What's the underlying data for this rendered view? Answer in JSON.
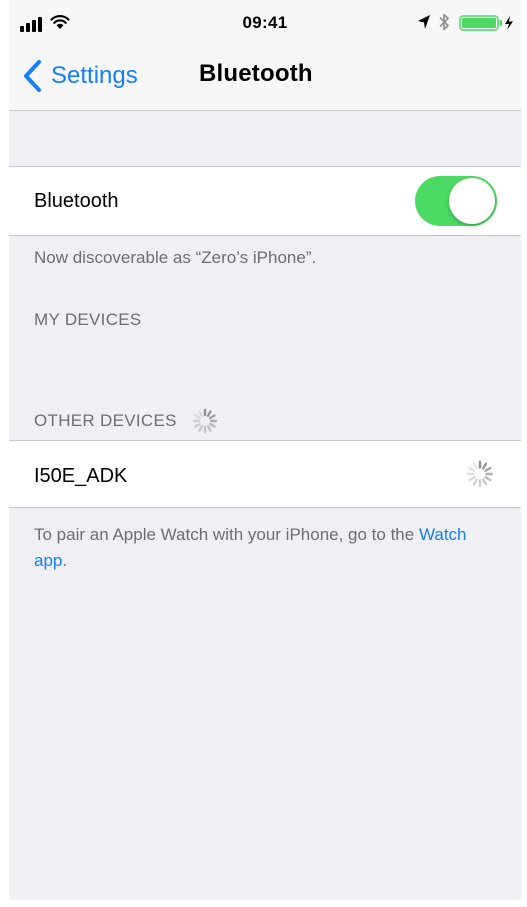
{
  "status_bar": {
    "time": "09:41",
    "icons": [
      "signal-bars-icon",
      "wifi-icon",
      "location-arrow-icon",
      "bluetooth-icon",
      "battery-charging-icon"
    ]
  },
  "nav": {
    "back_label": "Settings",
    "title": "Bluetooth"
  },
  "bluetooth_toggle": {
    "label": "Bluetooth",
    "state": "on"
  },
  "discoverable_text": "Now discoverable as “Zero’s iPhone”.",
  "my_devices": {
    "header": "MY DEVICES",
    "items": []
  },
  "other_devices": {
    "header": "OTHER DEVICES",
    "items": [
      {
        "name": "I50E_ADK",
        "status": "connecting"
      }
    ]
  },
  "pair_hint": {
    "text": "To pair an Apple Watch with your iPhone, go to the",
    "link": "Watch app",
    "suffix": "."
  },
  "colors": {
    "accent": "#157efb",
    "toggle_on": "#4cd964",
    "background": "#efeff4",
    "secondary_text": "#6d6d72"
  }
}
